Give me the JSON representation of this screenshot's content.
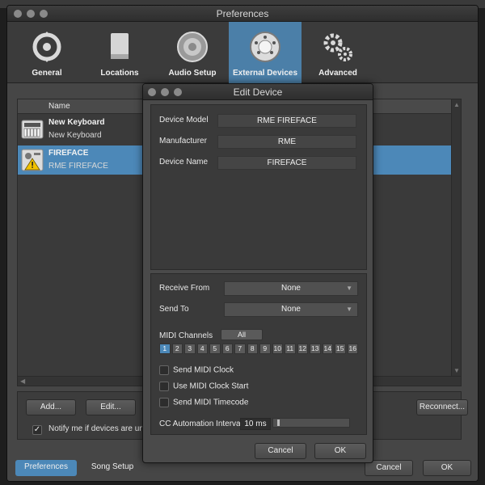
{
  "prefs": {
    "title": "Preferences",
    "toolbar": [
      {
        "label": "General",
        "icon": "general-cycle-icon"
      },
      {
        "label": "Locations",
        "icon": "locations-drive-icon"
      },
      {
        "label": "Audio Setup",
        "icon": "audio-speaker-icon"
      },
      {
        "label": "External Devices",
        "icon": "external-devices-dial-icon",
        "active": true
      },
      {
        "label": "Advanced",
        "icon": "advanced-gears-icon"
      }
    ],
    "list": {
      "column": "Name",
      "devices": [
        {
          "name": "New Keyboard",
          "model": "New Keyboard",
          "icon": "keyboard-icon"
        },
        {
          "name": "FIREFACE",
          "model": "RME FIREFACE",
          "icon": "fireface-warning-icon",
          "selected": true
        }
      ]
    },
    "buttons": {
      "add": "Add...",
      "edit": "Edit...",
      "reconnect": "Reconnect..."
    },
    "notify_label": "Notify me if devices are unava",
    "notify_checked": "✓",
    "bottom": {
      "preferences": "Preferences",
      "song_setup": "Song Setup",
      "cancel": "Cancel",
      "ok": "OK"
    }
  },
  "edit": {
    "title": "Edit Device",
    "device_model_label": "Device Model",
    "device_model": "RME FIREFACE",
    "manufacturer_label": "Manufacturer",
    "manufacturer": "RME",
    "device_name_label": "Device Name",
    "device_name": "FIREFACE",
    "receive_from_label": "Receive From",
    "receive_from": "None",
    "send_to_label": "Send To",
    "send_to": "None",
    "midi_channels_label": "MIDI Channels",
    "all_label": "All",
    "channels": [
      "1",
      "2",
      "3",
      "4",
      "5",
      "6",
      "7",
      "8",
      "9",
      "10",
      "11",
      "12",
      "13",
      "14",
      "15",
      "16"
    ],
    "active_channel": "1",
    "send_midi_clock": "Send MIDI Clock",
    "use_midi_clock_start": "Use MIDI Clock Start",
    "send_midi_timecode": "Send MIDI Timecode",
    "cc_interval_label": "CC Automation Interval",
    "cc_interval": "10 ms",
    "cc_interval_fraction": 0.03,
    "cancel": "Cancel",
    "ok": "OK"
  },
  "colors": {
    "accent": "#4c88b8",
    "panel": "#3a3a3a",
    "window": "#464646"
  }
}
